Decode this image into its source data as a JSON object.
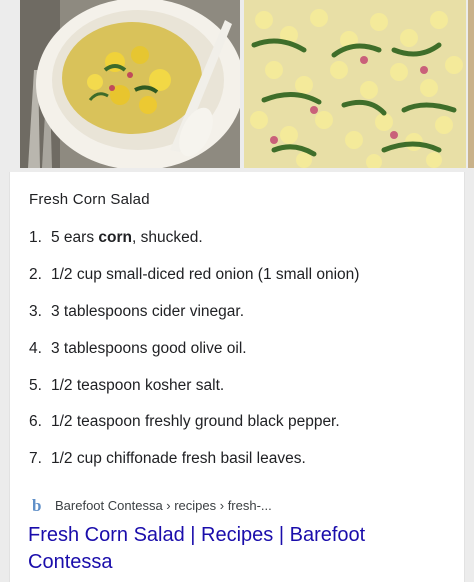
{
  "images": [
    {
      "name": "corn-salad-plate-photo"
    },
    {
      "name": "corn-basil-closeup-photo"
    },
    {
      "name": "cropped-third-photo"
    }
  ],
  "recipe": {
    "title": "Fresh Corn Salad",
    "ingredients": [
      {
        "number": "1.",
        "before": "5 ears ",
        "bold": "corn",
        "after": ", shucked."
      },
      {
        "number": "2.",
        "before": "1/2 cup small-diced red onion (1 small onion)",
        "bold": "",
        "after": ""
      },
      {
        "number": "3.",
        "before": "3 tablespoons cider vinegar.",
        "bold": "",
        "after": ""
      },
      {
        "number": "4.",
        "before": "3 tablespoons good olive oil.",
        "bold": "",
        "after": ""
      },
      {
        "number": "5.",
        "before": "1/2 teaspoon kosher salt.",
        "bold": "",
        "after": ""
      },
      {
        "number": "6.",
        "before": "1/2 teaspoon freshly ground black pepper.",
        "bold": "",
        "after": ""
      },
      {
        "number": "7.",
        "before": "1/2 cup chiffonade fresh basil leaves.",
        "bold": "",
        "after": ""
      }
    ]
  },
  "source": {
    "icon": "barefoot-contessa-b-icon",
    "breadcrumb": "Barefoot Contessa › recipes › fresh-..."
  },
  "result": {
    "link_text": "Fresh Corn Salad | Recipes | Barefoot Contessa"
  },
  "colors": {
    "link": "#1a0dab",
    "icon": "#5f8fc8",
    "text": "#202124"
  }
}
